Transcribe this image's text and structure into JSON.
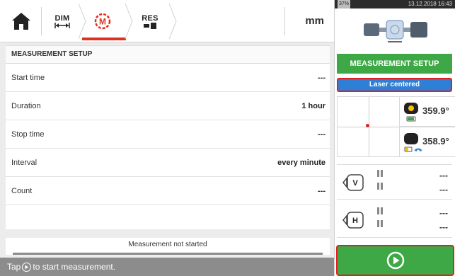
{
  "toolbar": {
    "home_icon": "home-icon",
    "dim_label": "DIM",
    "measure_icon": "measure-icon",
    "res_label": "RES",
    "unit": "mm"
  },
  "panel": {
    "title": "MEASUREMENT SETUP",
    "rows": [
      {
        "label": "Start time",
        "value": "---"
      },
      {
        "label": "Duration",
        "value": "1 hour"
      },
      {
        "label": "Stop time",
        "value": "---"
      },
      {
        "label": "Interval",
        "value": "every minute"
      },
      {
        "label": "Count",
        "value": "---"
      }
    ],
    "status": "Measurement not started"
  },
  "hint": {
    "before": "Tap",
    "after": "to start measurement."
  },
  "right": {
    "battery": "37%",
    "datetime": "13.12.2018 16:43",
    "setup_label": "MEASUREMENT SETUP",
    "laser_status": "Laser centered",
    "sensor1_angle": "359.9°",
    "sensor2_angle": "358.9°",
    "v_values": [
      "---",
      "---"
    ],
    "h_values": [
      "---",
      "---"
    ]
  },
  "colors": {
    "green": "#3da845",
    "blue": "#2f7fd6",
    "red": "#e02020",
    "hint_gray": "#8c8c8c"
  }
}
